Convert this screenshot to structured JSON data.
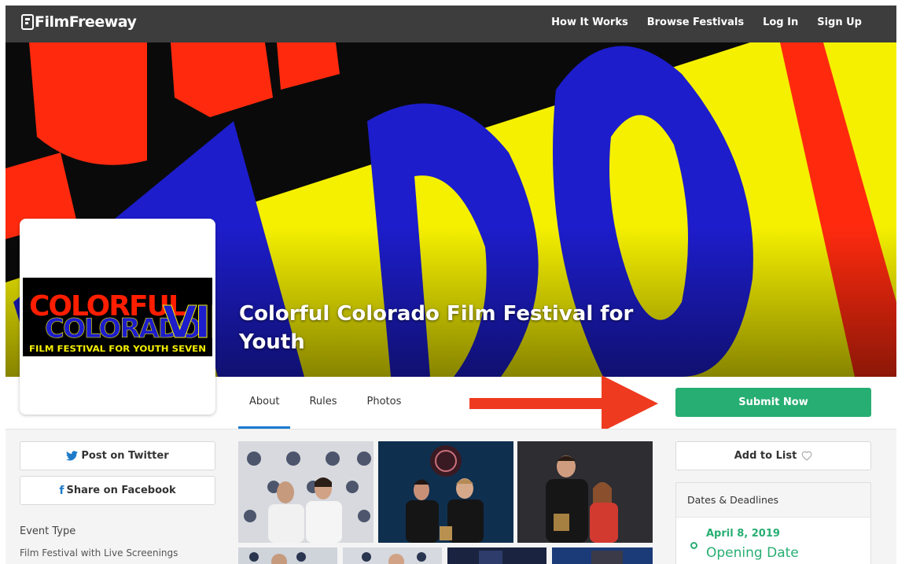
{
  "brand": {
    "name": "FilmFreeway"
  },
  "nav": {
    "items": [
      "How It Works",
      "Browse Festivals",
      "Log In",
      "Sign Up"
    ]
  },
  "festival": {
    "title": "Colorful Colorado Film Festival for Youth",
    "logo_text": {
      "line1": "COLORFUL",
      "line2": "COLORADO",
      "line3": "VII",
      "tagline": "FILM FESTIVAL FOR YOUTH SEVEN"
    }
  },
  "tabs": [
    {
      "label": "About",
      "active": true
    },
    {
      "label": "Rules",
      "active": false
    },
    {
      "label": "Photos",
      "active": false
    }
  ],
  "actions": {
    "submit_label": "Submit Now",
    "twitter_label": "Post on Twitter",
    "facebook_label": "Share on Facebook",
    "add_to_list_label": "Add to List"
  },
  "event": {
    "type_label": "Event Type",
    "type_value": "Film Festival with Live Screenings"
  },
  "dates": {
    "heading": "Dates & Deadlines",
    "items": [
      {
        "date": "April 8, 2019",
        "label": "Opening Date"
      }
    ]
  },
  "colors": {
    "accent_green": "#27ae72",
    "nav_bg": "#3d3d3d",
    "tab_underline": "#1a7bd0",
    "arrow_red": "#ee3a1f",
    "banner_yellow": "#f5f000",
    "banner_blue": "#1d1dcc",
    "banner_red": "#ff2a0e"
  },
  "icons": {
    "twitter": "twitter-bird-icon",
    "facebook": "facebook-f-icon",
    "heart": "heart-outline-icon",
    "date_marker": "timeline-dot-icon"
  }
}
